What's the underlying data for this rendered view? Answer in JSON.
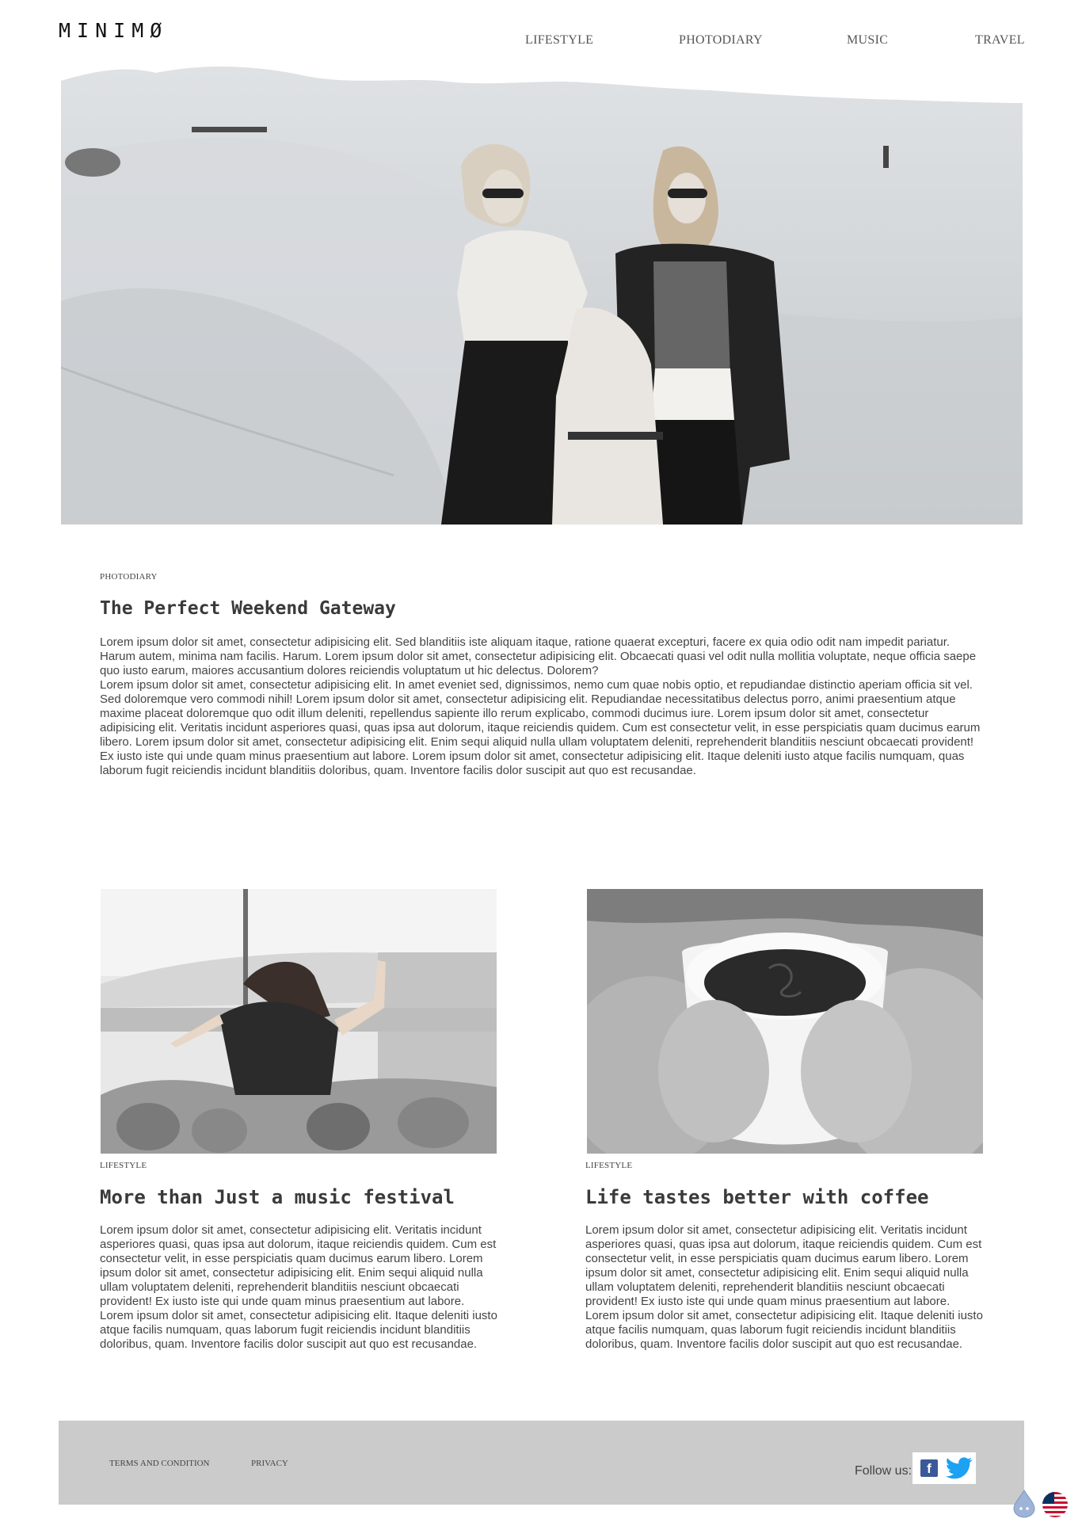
{
  "brand": {
    "logo": "MINIMØ"
  },
  "nav": {
    "items": [
      {
        "label": "LIFESTYLE"
      },
      {
        "label": "PHOTODIARY"
      },
      {
        "label": "MUSIC"
      },
      {
        "label": "TRAVEL"
      }
    ]
  },
  "hero": {
    "image": "two-women-in-sunglasses-on-sand-dunes-photo"
  },
  "featured": {
    "category": "PHOTODIARY",
    "title": "The Perfect Weekend Gateway",
    "paragraph1": "Lorem ipsum dolor sit amet, consectetur adipisicing elit. Sed blanditiis iste aliquam itaque, ratione quaerat excepturi, facere ex quia odio odit nam impedit pariatur. Harum autem, minima nam facilis. Harum. Lorem ipsum dolor sit amet, consectetur adipisicing elit. Obcaecati quasi vel odit nulla mollitia voluptate, neque officia saepe quo iusto earum, maiores accusantium dolores reiciendis voluptatum ut hic delectus. Dolorem?",
    "paragraph2": "Lorem ipsum dolor sit amet, consectetur adipisicing elit. In amet eveniet sed, dignissimos, nemo cum quae nobis optio, et repudiandae distinctio aperiam officia sit vel. Sed doloremque vero commodi nihil! Lorem ipsum dolor sit amet, consectetur adipisicing elit. Repudiandae necessitatibus delectus porro, animi praesentium atque maxime placeat doloremque quo odit illum deleniti, repellendus sapiente illo rerum explicabo, commodi ducimus iure. Lorem ipsum dolor sit amet, consectetur adipisicing elit. Veritatis incidunt asperiores quasi, quas ipsa aut dolorum, itaque reiciendis quidem. Cum est consectetur velit, in esse perspiciatis quam ducimus earum libero. Lorem ipsum dolor sit amet, consectetur adipisicing elit. Enim sequi aliquid nulla ullam voluptatem deleniti, reprehenderit blanditiis nesciunt obcaecati provident! Ex iusto iste qui unde quam minus praesentium aut labore. Lorem ipsum dolor sit amet, consectetur adipisicing elit. Itaque deleniti iusto atque facilis numquam, quas laborum fugit reiciendis incidunt blanditiis doloribus, quam. Inventore facilis dolor suscipit aut quo est recusandae."
  },
  "cards": [
    {
      "image": "woman-dancing-at-music-festival-crowd-photo",
      "category": "LIFESTYLE",
      "title": "More than Just a music festival",
      "text": "Lorem ipsum dolor sit amet, consectetur adipisicing elit. Veritatis incidunt asperiores quasi, quas ipsa aut dolorum, itaque reiciendis quidem. Cum est consectetur velit, in esse perspiciatis quam ducimus earum libero. Lorem ipsum dolor sit amet, consectetur adipisicing elit. Enim sequi aliquid nulla ullam voluptatem deleniti, reprehenderit blanditiis nesciunt obcaecati provident! Ex iusto iste qui unde quam minus praesentium aut labore. Lorem ipsum dolor sit amet, consectetur adipisicing elit. Itaque deleniti iusto atque facilis numquam, quas laborum fugit reiciendis incidunt blanditiis doloribus, quam. Inventore facilis dolor suscipit aut quo est recusandae."
    },
    {
      "image": "coffee-cup-in-knitted-mittens-photo",
      "category": "LIFESTYLE",
      "title": "Life tastes better with coffee",
      "text": "Lorem ipsum dolor sit amet, consectetur adipisicing elit. Veritatis incidunt asperiores quasi, quas ipsa aut dolorum, itaque reiciendis quidem. Cum est consectetur velit, in esse perspiciatis quam ducimus earum libero. Lorem ipsum dolor sit amet, consectetur adipisicing elit. Enim sequi aliquid nulla ullam voluptatem deleniti, reprehenderit blanditiis nesciunt obcaecati provident! Ex iusto iste qui unde quam minus praesentium aut labore. Lorem ipsum dolor sit amet, consectetur adipisicing elit. Itaque deleniti iusto atque facilis numquam, quas laborum fugit reiciendis incidunt blanditiis doloribus, quam. Inventore facilis dolor suscipit aut quo est recusandae."
    }
  ],
  "footer": {
    "links": [
      {
        "label": "TERMS AND CONDITION"
      },
      {
        "label": "PRIVACY"
      }
    ],
    "follow_label": "Follow us:",
    "social": [
      {
        "icon": "facebook-icon",
        "glyph": "f",
        "color": "#3b5998"
      },
      {
        "icon": "twitter-icon",
        "color": "#1da1f2"
      }
    ],
    "background": "#cccbcc"
  },
  "overlay": {
    "icons": [
      "water-drop-icon",
      "us-flag-icon"
    ]
  }
}
